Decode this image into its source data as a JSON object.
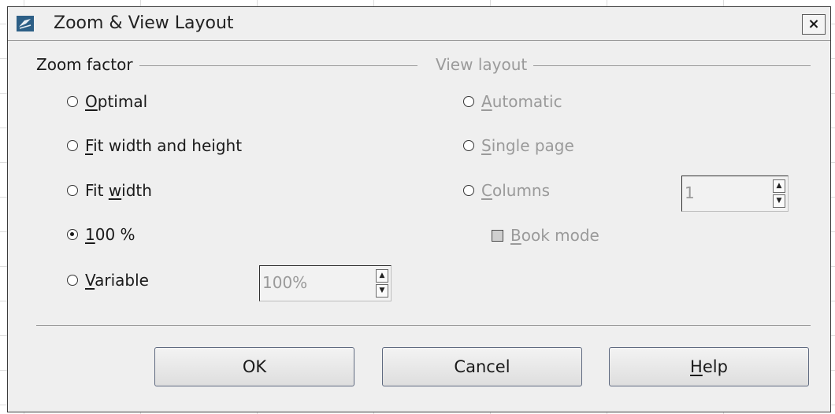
{
  "dialog": {
    "title": "Zoom & View Layout",
    "close_label": "×"
  },
  "zoom_factor": {
    "heading": "Zoom factor",
    "options": [
      {
        "label_u": "O",
        "label_rest": "ptimal",
        "checked": false
      },
      {
        "label_u": "F",
        "label_rest": "it width and height",
        "checked": false
      },
      {
        "label_pre": "Fit ",
        "label_u": "w",
        "label_rest": "idth",
        "checked": false
      },
      {
        "label_u": "1",
        "label_rest": "00 %",
        "checked": true
      },
      {
        "label_u": "V",
        "label_rest": "ariable",
        "checked": false
      }
    ],
    "variable_value": "100%"
  },
  "view_layout": {
    "heading": "View layout",
    "options": [
      {
        "label_u": "A",
        "label_rest": "utomatic"
      },
      {
        "label_u": "S",
        "label_rest": "ingle page"
      },
      {
        "label_u": "C",
        "label_rest": "olumns"
      }
    ],
    "columns_value": "1",
    "book_mode_u": "B",
    "book_mode_rest": "ook mode"
  },
  "buttons": {
    "ok": "OK",
    "cancel": "Cancel",
    "help_u": "H",
    "help_rest": "elp"
  },
  "icons": {
    "app": "writer-app-icon",
    "close": "close-icon",
    "spin_up": "▲",
    "spin_down": "▼"
  }
}
